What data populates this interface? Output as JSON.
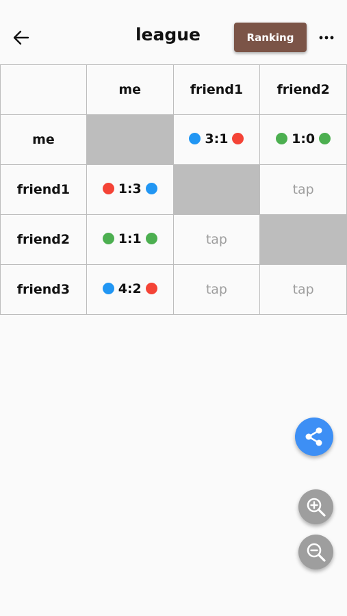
{
  "appbar": {
    "title": "league",
    "ranking_label": "Ranking",
    "back_icon": "arrow-left-icon",
    "more_icon": "more-horizontal-icon"
  },
  "table": {
    "columns": [
      "",
      "me",
      "friend1",
      "friend2"
    ],
    "rows": [
      {
        "name": "me",
        "cells": [
          {
            "type": "self"
          },
          {
            "type": "score",
            "score": "3:1",
            "left": "#2196f3",
            "right": "#f44336"
          },
          {
            "type": "score",
            "score": "1:0",
            "left": "#4caf50",
            "right": "#4caf50"
          }
        ]
      },
      {
        "name": "friend1",
        "cells": [
          {
            "type": "score",
            "score": "1:3",
            "left": "#f44336",
            "right": "#2196f3"
          },
          {
            "type": "self"
          },
          {
            "type": "tap",
            "text": "tap"
          }
        ]
      },
      {
        "name": "friend2",
        "cells": [
          {
            "type": "score",
            "score": "1:1",
            "left": "#4caf50",
            "right": "#4caf50"
          },
          {
            "type": "tap",
            "text": "tap"
          },
          {
            "type": "self"
          }
        ]
      },
      {
        "name": "friend3",
        "cells": [
          {
            "type": "score",
            "score": "4:2",
            "left": "#2196f3",
            "right": "#f44336"
          },
          {
            "type": "tap",
            "text": "tap"
          },
          {
            "type": "tap",
            "text": "tap"
          }
        ]
      }
    ]
  },
  "fabs": {
    "share_icon": "share-icon",
    "zoom_in_icon": "zoom-in-icon",
    "zoom_out_icon": "zoom-out-icon"
  },
  "colors": {
    "ranking_bg": "#7b5447",
    "share_bg": "#3d8ff5",
    "zoom_bg": "#9e9e9e",
    "self_cell": "#bdbdbd"
  }
}
